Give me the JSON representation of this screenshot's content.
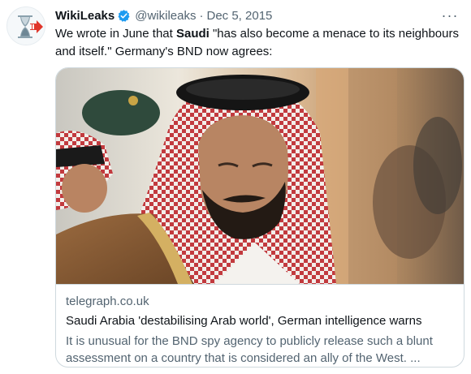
{
  "tweet": {
    "author_name": "WikiLeaks",
    "handle": "@wikileaks",
    "separator": "·",
    "date": "Dec 5, 2015",
    "more": "···",
    "text_prefix": "We wrote in June that ",
    "text_bold": "Saudi",
    "text_line1_suffix": " \"has also become a menace to its neighbours",
    "text_line2": "and itself.\" Germany's BND now agrees:"
  },
  "card": {
    "domain": "telegraph.co.uk",
    "title": "Saudi Arabia 'destabilising Arab world', German intelligence warns",
    "desc_line1": "It is unusual for the BND spy agency to publicly release such a blunt",
    "desc_line2": "assessment on a country that is considered an ally of the West. ..."
  },
  "icons": {
    "avatar": "wikileaks-hourglass-logo",
    "verified": "verified-badge-icon",
    "more": "more-options-icon"
  },
  "colors": {
    "verified": "#1d9bf0",
    "text": "#0f1419",
    "secondary": "#536471",
    "border": "#cfd9de"
  }
}
